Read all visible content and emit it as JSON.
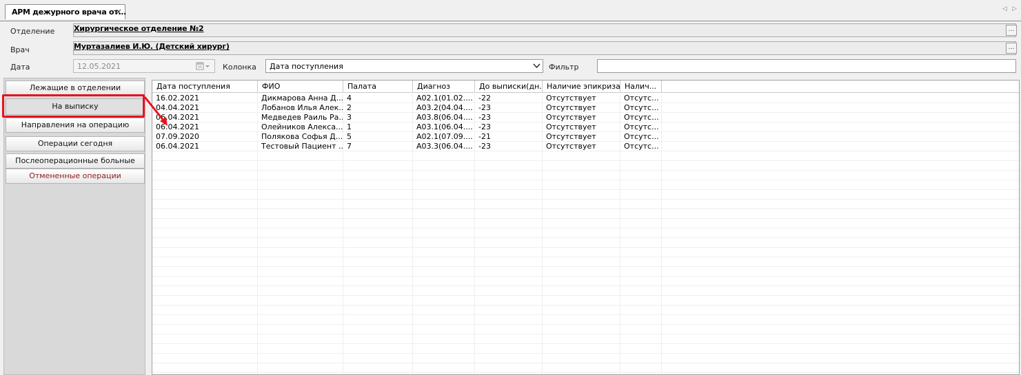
{
  "tab": {
    "title": "АРМ дежурного врача от...",
    "close": "×"
  },
  "tab_scroll": {
    "left": "◁",
    "right": "▷"
  },
  "header": {
    "department_label": "Отделение",
    "department_value": "Хирургическое отделение №2",
    "doctor_label": "Врач",
    "doctor_value": "Муртазалиев И.Ю. (Детский хирург)",
    "date_label": "Дата",
    "date_value": "12.05.2021",
    "column_label": "Колонка",
    "column_value": "Дата поступления",
    "filter_label": "Фильтр",
    "filter_value": "",
    "ellipsis": "..."
  },
  "nav": {
    "items": [
      {
        "label": "Лежащие в отделении"
      },
      {
        "label": "На выписку"
      },
      {
        "label": "Направления на операцию"
      },
      {
        "label": "Операции сегодня"
      },
      {
        "label": "Послеоперационные больные"
      },
      {
        "label": "Отмененные операции"
      }
    ],
    "active_index": 1
  },
  "grid": {
    "columns": [
      "Дата поступления",
      "ФИО",
      "Палата",
      "Диагноз",
      "До выписки(дн.)",
      "Наличие эпикриза",
      "Налич..."
    ],
    "rows": [
      [
        "16.02.2021",
        "Дикмарова Анна Д...",
        "4",
        "A02.1(01.02....",
        "-22",
        "Отсутствует",
        "Отсутс..."
      ],
      [
        "04.04.2021",
        "Лобанов Илья Алек...",
        "2",
        "A03.2(04.04....",
        "-23",
        "Отсутствует",
        "Отсутс..."
      ],
      [
        "06.04.2021",
        "Медведев Раиль Ра...",
        "3",
        "A03.8(06.04....",
        "-23",
        "Отсутствует",
        "Отсутс..."
      ],
      [
        "06.04.2021",
        "Олейников Алекса...",
        "1",
        "A03.1(06.04....",
        "-23",
        "Отсутствует",
        "Отсутс..."
      ],
      [
        "07.09.2020",
        "Полякова Софья Д...",
        "5",
        "A02.1(07.09....",
        "-21",
        "Отсутствует",
        "Отсутс..."
      ],
      [
        "06.04.2021",
        "Тестовый Пациент ...",
        "7",
        "A03.3(06.04....",
        "-23",
        "Отсутствует",
        "Отсутс..."
      ]
    ]
  },
  "colors": {
    "highlight": "#e8121d",
    "cancel_text": "#8b1c1c"
  }
}
